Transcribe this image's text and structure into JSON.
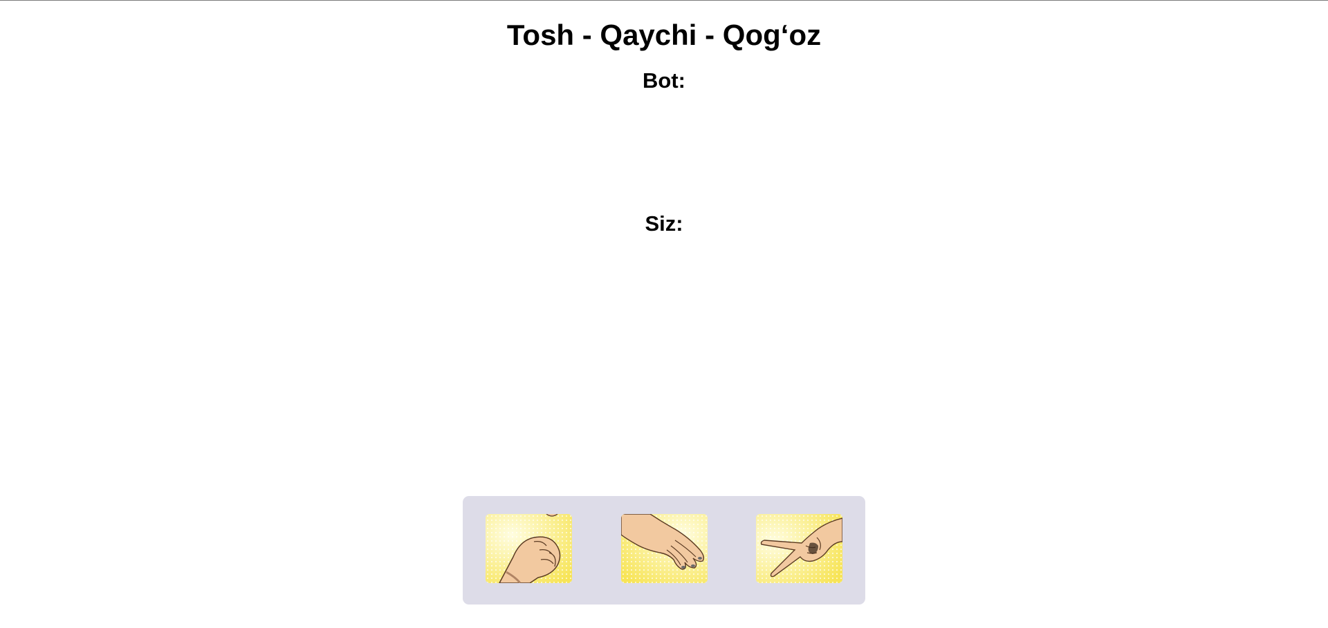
{
  "page": {
    "title": "Tosh - Qaychi - Qog‘oz"
  },
  "bot": {
    "label": "Bot:"
  },
  "player": {
    "label": "Siz:"
  },
  "choices": [
    {
      "id": "rock",
      "icon": "fist-icon"
    },
    {
      "id": "paper",
      "icon": "open-hand-icon"
    },
    {
      "id": "scissors",
      "icon": "scissors-hand-icon"
    }
  ],
  "colors": {
    "panel": "#dddce8",
    "card_yellow": "#fbe96a",
    "skin": "#f2c9a0"
  }
}
